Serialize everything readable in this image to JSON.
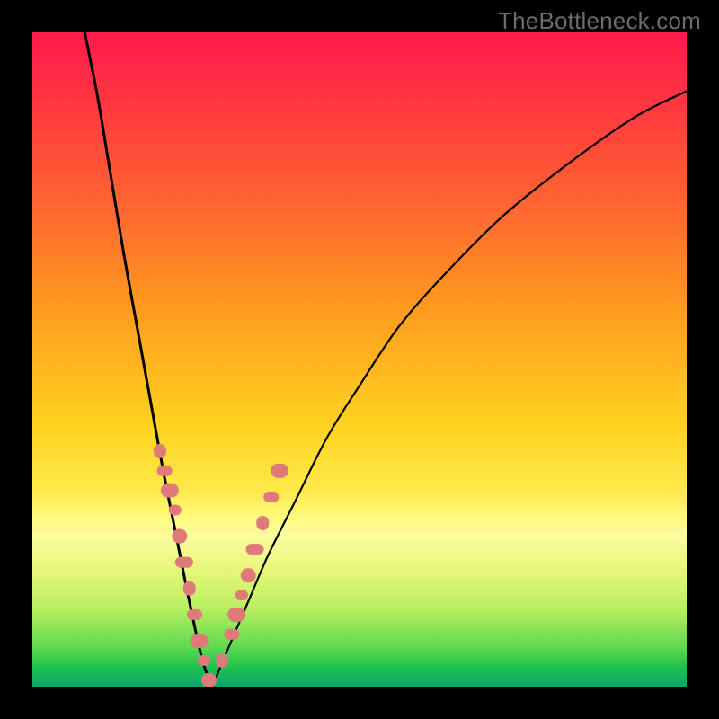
{
  "watermark": {
    "text": "TheBottleneck.com"
  },
  "colors": {
    "frame": "#000000",
    "curve": "#000000",
    "marker_fill": "#e07a7a",
    "marker_stroke": "#c96262"
  },
  "chart_data": {
    "type": "line",
    "title": "",
    "xlabel": "",
    "ylabel": "",
    "xlim": [
      0,
      100
    ],
    "ylim": [
      0,
      100
    ],
    "grid": false,
    "legend": false,
    "note": "Values are estimated from pixel positions; the chart shows two bottleneck curves meeting near x≈27, y≈0 with salmon-colored data markers clustered along both branches in the lower-left region.",
    "series": [
      {
        "name": "left-curve",
        "x": [
          8,
          10,
          12,
          14,
          16,
          18,
          20,
          22,
          24,
          26,
          27.5
        ],
        "y": [
          100,
          90,
          78,
          66,
          55,
          44,
          33,
          23,
          13,
          4,
          0
        ]
      },
      {
        "name": "right-curve",
        "x": [
          27.5,
          30,
          33,
          36,
          40,
          45,
          50,
          56,
          63,
          72,
          82,
          92,
          100
        ],
        "y": [
          0,
          6,
          13,
          20,
          28,
          38,
          46,
          55,
          63,
          72,
          80,
          87,
          91
        ]
      },
      {
        "name": "markers-left",
        "x": [
          19.5,
          20.2,
          21.0,
          21.8,
          22.5,
          23.2,
          24.0,
          24.8,
          25.5,
          26.2,
          27.0
        ],
        "y": [
          36,
          33,
          30,
          27,
          23,
          19,
          15,
          11,
          7,
          4,
          1
        ]
      },
      {
        "name": "markers-right",
        "x": [
          29.0,
          30.5,
          31.2,
          32.0,
          33.0,
          34.0,
          35.2,
          36.5,
          37.8
        ],
        "y": [
          4,
          8,
          11,
          14,
          17,
          21,
          25,
          29,
          33
        ]
      }
    ]
  }
}
